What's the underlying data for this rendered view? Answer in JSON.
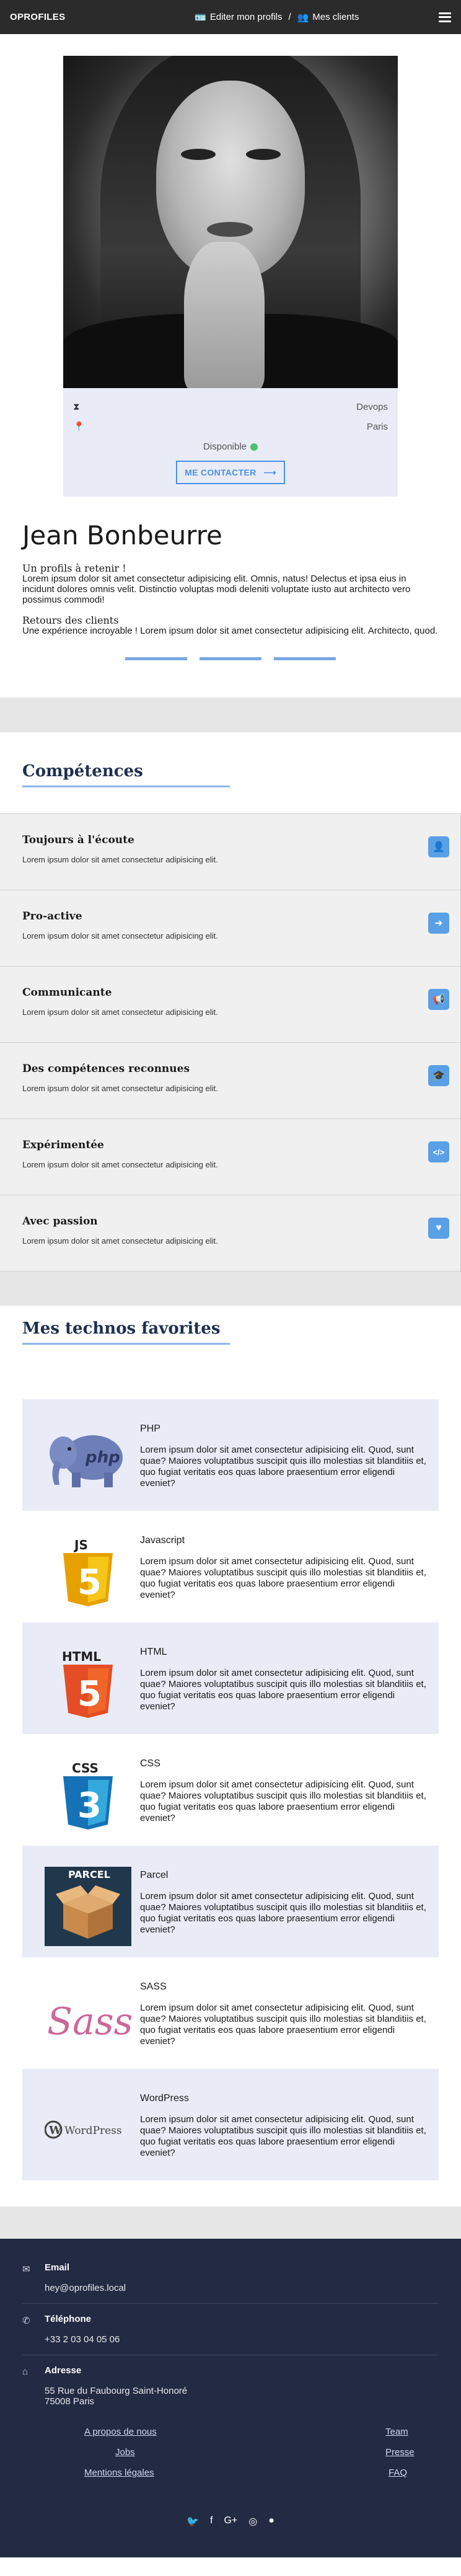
{
  "header": {
    "brand": "OPROFILES",
    "edit_label": "Editer mon profils",
    "separator": "/",
    "clients_label": "Mes clients"
  },
  "profile": {
    "job": "Devops",
    "city": "Paris",
    "availability": "Disponible",
    "contact_label": "ME CONTACTER",
    "contact_arrow": "⟶",
    "name": "Jean Bonbeurre",
    "retain_title": "Un profils à retenir !",
    "retain_text": "Lorem ipsum dolor sit amet consectetur adipisicing elit. Omnis, natus! Delectus et ipsa eius in incidunt dolores omnis velit. Distinctio voluptas modi deleniti voluptate iusto aut architecto vero possimus commodi!",
    "feedback_title": "Retours des clients",
    "feedback_text": "Une expérience incroyable ! Lorem ipsum dolor sit amet consectetur adipisicing elit. Architecto, quod."
  },
  "competences": {
    "title": "Compétences",
    "items": [
      {
        "title": "Toujours à l'écoute",
        "text": "Lorem ipsum dolor sit amet consectetur adipisicing elit.",
        "icon": "user-icon",
        "glyph": "👤"
      },
      {
        "title": "Pro-active",
        "text": "Lorem ipsum dolor sit amet consectetur adipisicing elit.",
        "icon": "arrow-right-icon",
        "glyph": "➜"
      },
      {
        "title": "Communicante",
        "text": "Lorem ipsum dolor sit amet consectetur adipisicing elit.",
        "icon": "bullhorn-icon",
        "glyph": "📢"
      },
      {
        "title": "Des compétences reconnues",
        "text": "Lorem ipsum dolor sit amet consectetur adipisicing elit.",
        "icon": "graduation-cap-icon",
        "glyph": "🎓"
      },
      {
        "title": "Expérimentée",
        "text": "Lorem ipsum dolor sit amet consectetur adipisicing elit.",
        "icon": "code-icon",
        "glyph": "</>"
      },
      {
        "title": "Avec passion",
        "text": "Lorem ipsum dolor sit amet consectetur adipisicing elit.",
        "icon": "heart-icon",
        "glyph": "♥"
      }
    ]
  },
  "technos": {
    "title": "Mes technos favorites",
    "items": [
      {
        "name": "PHP",
        "logo": "php-logo",
        "text": "Lorem ipsum dolor sit amet consectetur adipisicing elit. Quod, sunt quae? Maiores voluptatibus suscipit quis illo molestias sit blanditiis et, quo fugiat veritatis eos quas labore praesentium error eligendi eveniet?"
      },
      {
        "name": "Javascript",
        "logo": "js-logo",
        "text": "Lorem ipsum dolor sit amet consectetur adipisicing elit. Quod, sunt quae? Maiores voluptatibus suscipit quis illo molestias sit blanditiis et, quo fugiat veritatis eos quas labore praesentium error eligendi eveniet?"
      },
      {
        "name": "HTML",
        "logo": "html-logo",
        "text": "Lorem ipsum dolor sit amet consectetur adipisicing elit. Quod, sunt quae? Maiores voluptatibus suscipit quis illo molestias sit blanditiis et, quo fugiat veritatis eos quas labore praesentium error eligendi eveniet?"
      },
      {
        "name": "CSS",
        "logo": "css-logo",
        "text": "Lorem ipsum dolor sit amet consectetur adipisicing elit. Quod, sunt quae? Maiores voluptatibus suscipit quis illo molestias sit blanditiis et, quo fugiat veritatis eos quas labore praesentium error eligendi eveniet?"
      },
      {
        "name": "Parcel",
        "logo": "parcel-logo",
        "text": "Lorem ipsum dolor sit amet consectetur adipisicing elit. Quod, sunt quae? Maiores voluptatibus suscipit quis illo molestias sit blanditiis et, quo fugiat veritatis eos quas labore praesentium error eligendi eveniet?"
      },
      {
        "name": "SASS",
        "logo": "sass-logo",
        "text": "Lorem ipsum dolor sit amet consectetur adipisicing elit. Quod, sunt quae? Maiores voluptatibus suscipit quis illo molestias sit blanditiis et, quo fugiat veritatis eos quas labore praesentium error eligendi eveniet?"
      },
      {
        "name": "WordPress",
        "logo": "wordpress-logo",
        "text": "Lorem ipsum dolor sit amet consectetur adipisicing elit. Quod, sunt quae? Maiores voluptatibus suscipit quis illo molestias sit blanditiis et, quo fugiat veritatis eos quas labore praesentium error eligendi eveniet?"
      }
    ],
    "logo_text": {
      "js": "JS",
      "html": "HTML",
      "css": "CSS",
      "parcel": "PARCEL",
      "sass": "Sass",
      "wordpress": "WordPress"
    }
  },
  "footer": {
    "email_label": "Email",
    "email_value": "hey@oprofiles.local",
    "phone_label": "Téléphone",
    "phone_value": "+33 2 03 04 05 06",
    "address_label": "Adresse",
    "address_line1": "55 Rue du Faubourg Saint-Honoré",
    "address_line2": "75008 Paris",
    "links": [
      "A propos de nous",
      "Team",
      "Jobs",
      "Presse",
      "Mentions légales",
      "FAQ"
    ]
  },
  "colors": {
    "accent": "#4a90e2",
    "available": "#4fbf6f",
    "footer_bg": "#232a43",
    "header_bg": "#2b2b2b"
  }
}
